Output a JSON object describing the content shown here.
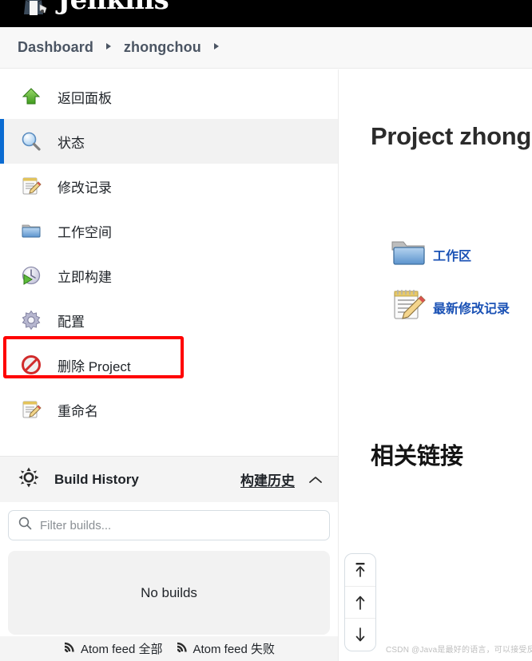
{
  "topbar": {
    "brand_text": "Jenkins",
    "logo_icon": "jenkins-butler-logo"
  },
  "breadcrumb": {
    "items": [
      {
        "label": "Dashboard",
        "icon": "chevron-right-icon"
      },
      {
        "label": "zhongchou",
        "icon": "chevron-right-icon"
      }
    ]
  },
  "sidebar": {
    "tasks": [
      {
        "label": "返回面板",
        "icon": "green-up-arrow-icon",
        "active": false
      },
      {
        "label": "状态",
        "icon": "magnifier-icon",
        "active": true
      },
      {
        "label": "修改记录",
        "icon": "notepad-pencil-icon",
        "active": false
      },
      {
        "label": "工作空间",
        "icon": "folder-icon",
        "active": false
      },
      {
        "label": "立即构建",
        "icon": "build-now-clock-play-icon",
        "active": false
      },
      {
        "label": "配置",
        "icon": "gear-icon",
        "active": false
      },
      {
        "label": "删除 Project",
        "icon": "delete-prohibition-icon",
        "active": false
      },
      {
        "label": "重命名",
        "icon": "rename-notepad-pencil-icon",
        "active": false
      }
    ],
    "build_history": {
      "icon": "build-history-sun-icon",
      "title": "Build History",
      "annotation": "构建历史",
      "collapse_icon": "chevron-up-icon"
    },
    "filter": {
      "icon": "search-icon",
      "placeholder": "Filter builds...",
      "value": ""
    },
    "builds_empty_text": "No builds",
    "atom_feeds": [
      {
        "label": "Atom feed 全部",
        "icon": "rss-icon"
      },
      {
        "label": "Atom feed 失败",
        "icon": "rss-icon"
      }
    ]
  },
  "main": {
    "project_title": "Project zhongchou",
    "links": [
      {
        "label": "工作区",
        "icon": "folder-icon"
      },
      {
        "label": "最新修改记录",
        "icon": "notepad-pencil-icon"
      }
    ],
    "related_heading": "相关链接"
  },
  "scroll_widget": {
    "buttons": [
      {
        "icon": "jump-to-top-icon"
      },
      {
        "icon": "arrow-up-icon"
      },
      {
        "icon": "arrow-down-icon"
      }
    ]
  },
  "watermark": {
    "text": "CSDN @Java是最好的语言，可以接受反驳"
  },
  "colors": {
    "accent_blue": "#0b6cd2",
    "link_blue": "#1b52b5",
    "annotation_red": "#ff0000",
    "topbar_black": "#000000",
    "panel_grey": "#f2f2f2"
  }
}
